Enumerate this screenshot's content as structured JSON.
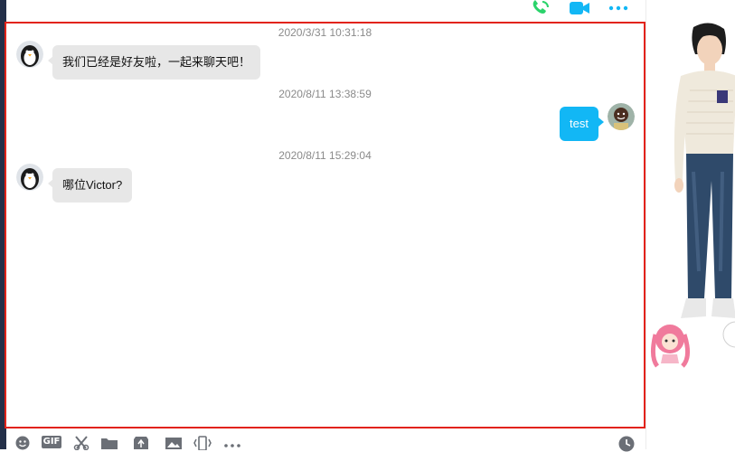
{
  "header": {
    "icons": [
      "phone-icon",
      "video-call-icon",
      "more-icon"
    ]
  },
  "messages": [
    {
      "time": "2020/3/31 10:31:18",
      "direction": "incoming",
      "text": "我们已经是好友啦，一起来聊天吧！"
    },
    {
      "time": "2020/8/11 13:38:59",
      "direction": "outgoing",
      "text": "test"
    },
    {
      "time": "2020/8/11 15:29:04",
      "direction": "incoming",
      "text": "哪位Victor?"
    }
  ],
  "toolbar": {
    "icons": [
      "emoji-icon",
      "gif-icon",
      "screenshot-icon",
      "folder-icon",
      "file-transfer-icon",
      "image-icon",
      "shake-icon",
      "more-icon",
      "history-icon"
    ],
    "gif_label": "GIF"
  },
  "colors": {
    "outgoing_bubble": "#12b7f5",
    "incoming_bubble": "#e7e7e7",
    "call_icon": "#2bd36b",
    "video_icon": "#12b7f5",
    "highlight_border": "#e2231a"
  }
}
